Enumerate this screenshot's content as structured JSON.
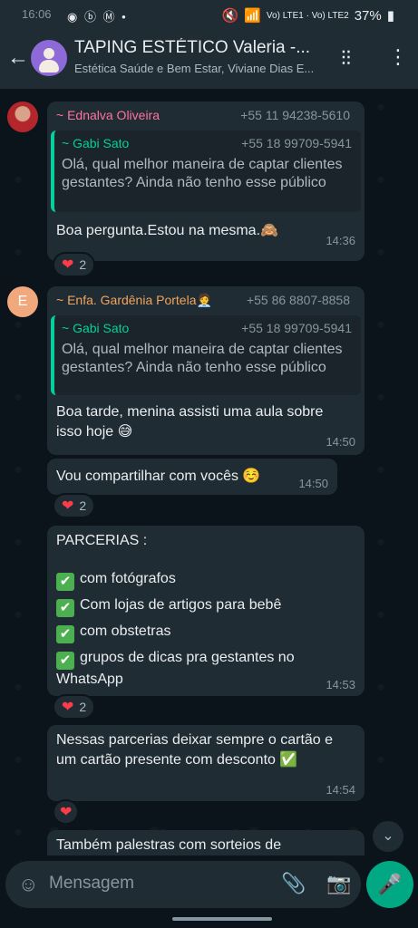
{
  "status": {
    "time": "16:06",
    "left_icons": "◉ ⓑ Ⓜ •",
    "network": "Vo) LTE1 · Vo) LTE2",
    "battery": "37%"
  },
  "header": {
    "title": "TAPING ESTÉTICO Valeria -...",
    "subtitle": "Estética Saúde e Bem Estar, Viviane Dias E..."
  },
  "messages": [
    {
      "sender": "~ Ednalva Oliveira",
      "phone": "+55 11 94238-5610",
      "quote_name": "~ Gabi Sato",
      "quote_phone": "+55 18 99709-5941",
      "quote_text": "Olá, qual melhor maneira de captar clientes gestantes? Ainda não tenho esse público",
      "text": "Boa pergunta.Estou na mesma.🙈",
      "time": "14:36",
      "reaction": "2"
    },
    {
      "sender": "~ Enfa. Gardênia Portela🧑‍💼",
      "phone": "+55 86 8807-8858",
      "quote_name": "~ Gabi Sato",
      "quote_phone": "+55 18 99709-5941",
      "quote_text": "Olá, qual melhor maneira de captar clientes gestantes? Ainda não tenho esse público",
      "text": "Boa tarde, menina assisti uma aula sobre isso hoje 😅",
      "time": "14:50",
      "avatar_letter": "E"
    },
    {
      "text": "Vou compartilhar com vocês ☺️",
      "time": "14:50",
      "reaction": "2"
    },
    {
      "title": "PARCERIAS :",
      "items": [
        "com fotógrafos",
        "Com lojas de artigos para bebê",
        "com obstetras",
        "grupos de dicas pra gestantes no WhatsApp"
      ],
      "time": "14:53",
      "reaction": "2"
    },
    {
      "text": "Nessas parcerias deixar sempre o cartão e um cartão presente com desconto ✅",
      "time": "14:54"
    },
    {
      "text": "Também palestras com sorteios de"
    }
  ],
  "input": {
    "placeholder": "Mensagem"
  },
  "colors": {
    "accent": "#00a884",
    "sender1": "#ff72a1",
    "sender2": "#f0a45c"
  }
}
